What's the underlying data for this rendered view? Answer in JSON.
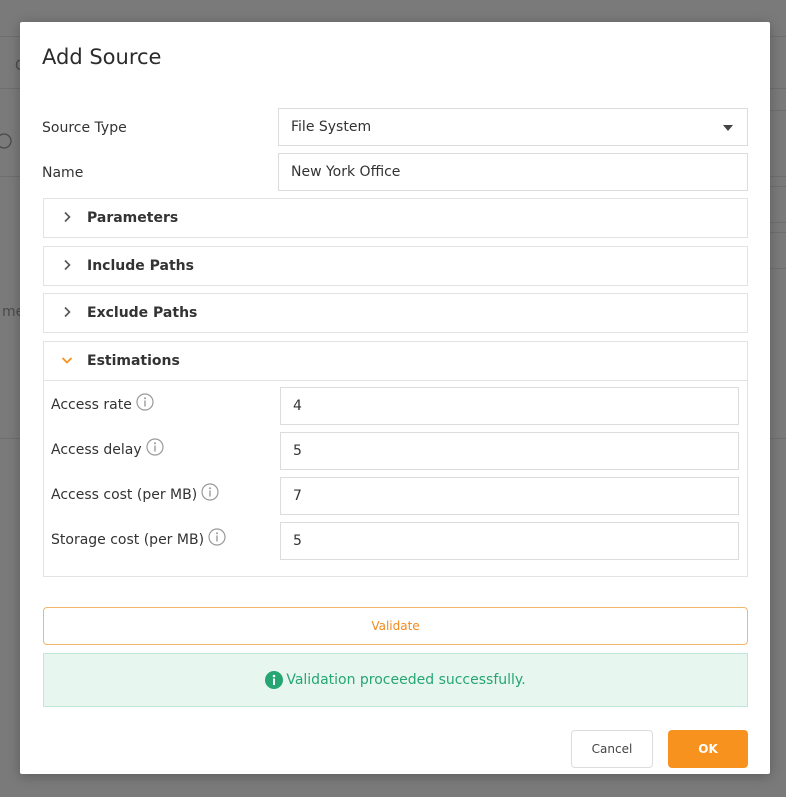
{
  "dialog": {
    "title": "Add Source"
  },
  "form": {
    "source_type_label": "Source Type",
    "source_type_value": "File System",
    "name_label": "Name",
    "name_value": "New York Office"
  },
  "panels": [
    {
      "title": "Parameters",
      "expanded": false
    },
    {
      "title": "Include Paths",
      "expanded": false
    },
    {
      "title": "Exclude Paths",
      "expanded": false
    },
    {
      "title": "Estimations",
      "expanded": true
    }
  ],
  "estimations": [
    {
      "label": "Access rate",
      "value": "4"
    },
    {
      "label": "Access delay",
      "value": "5"
    },
    {
      "label": "Access cost (per MB)",
      "value": "7"
    },
    {
      "label": "Storage cost (per MB)",
      "value": "5"
    }
  ],
  "validate_label": "Validate",
  "status_message": "Validation proceeded successfully.",
  "buttons": {
    "cancel": "Cancel",
    "ok": "OK"
  },
  "background_fragments": {
    "c": "C",
    "me": "me"
  },
  "icons": {
    "dropdown": "caret-down-icon",
    "collapsed": "chevron-right-icon",
    "expanded": "chevron-down-icon",
    "info": "info-icon",
    "success": "success-info-icon"
  },
  "colors": {
    "accent": "#f7921e",
    "success_text": "#26a672",
    "success_bg": "#e8f6f0"
  }
}
